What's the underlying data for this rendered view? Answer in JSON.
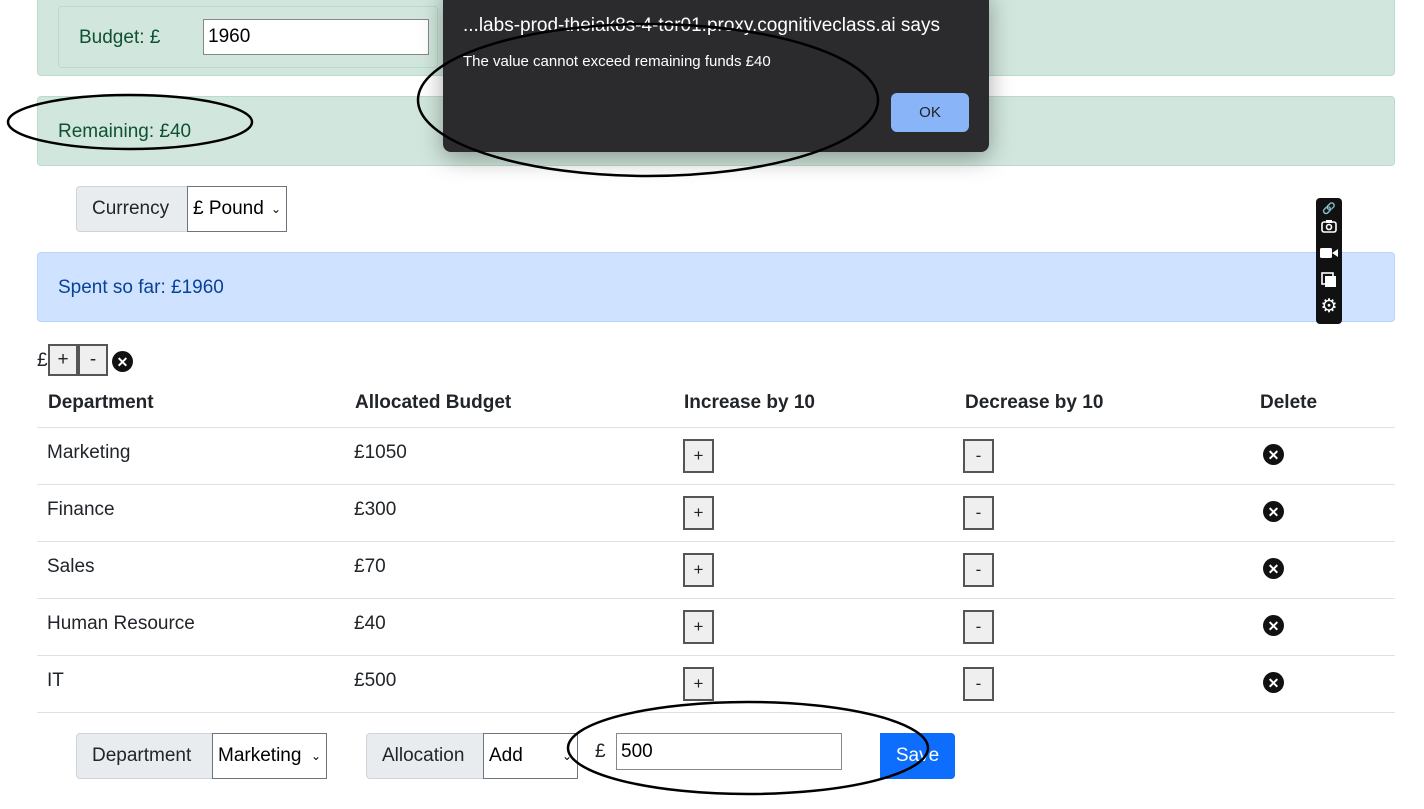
{
  "budget": {
    "label": "Budget: £",
    "value": "1960"
  },
  "remaining": {
    "text": "Remaining: £40"
  },
  "currency": {
    "label": "Currency",
    "selected": "£ Pound"
  },
  "spent": {
    "text": "Spent so far: £1960"
  },
  "header_controls": {
    "currency_symbol": "£",
    "plus": "+",
    "minus": "-"
  },
  "table": {
    "columns": [
      "Department",
      "Allocated Budget",
      "Increase by 10",
      "Decrease by 10",
      "Delete"
    ],
    "rows": [
      {
        "department": "Marketing",
        "budget": "£1050"
      },
      {
        "department": "Finance",
        "budget": "£300"
      },
      {
        "department": "Sales",
        "budget": "£70"
      },
      {
        "department": "Human Resource",
        "budget": "£40"
      },
      {
        "department": "IT",
        "budget": "£500"
      }
    ],
    "increase_label": "+",
    "decrease_label": "-"
  },
  "form": {
    "department_label": "Department",
    "department_selected": "Marketing",
    "allocation_label": "Allocation",
    "allocation_selected": "Add",
    "currency_symbol": "£",
    "amount_value": "500",
    "save_label": "Save"
  },
  "dialog": {
    "title": "...labs-prod-theiak8s-4-tor01.proxy.cognitiveclass.ai says",
    "message": "The value cannot exceed remaining funds £40",
    "ok_label": "OK"
  },
  "toolbar": {
    "icons": [
      "link-icon",
      "camera-icon",
      "video-icon",
      "copy-icon",
      "gear-icon"
    ]
  },
  "colors": {
    "success_bg": "#d1e7dd",
    "info_bg": "#cfe2ff",
    "primary": "#0d6efd",
    "dialog_bg": "#2b2b2e",
    "dialog_button": "#8ab4f8"
  }
}
